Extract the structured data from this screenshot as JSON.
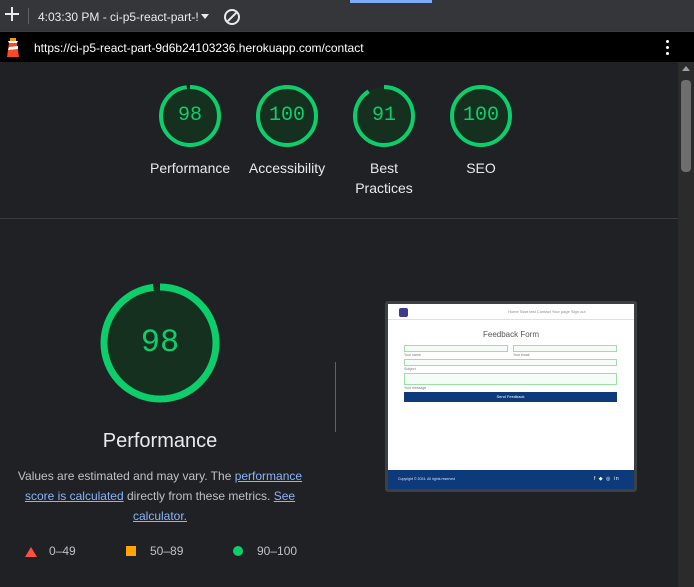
{
  "toolbar": {
    "report_label": "4:03:30 PM - ci-p5-react-part-!"
  },
  "urlbar": {
    "url": "https://ci-p5-react-part-9d6b24103236.herokuapp.com/contact"
  },
  "summary_gauges": [
    {
      "score": "98",
      "label": "Performance"
    },
    {
      "score": "100",
      "label": "Accessibility"
    },
    {
      "score": "91",
      "label_line1": "Best",
      "label_line2": "Practices"
    },
    {
      "score": "100",
      "label": "SEO"
    }
  ],
  "performance": {
    "score": "98",
    "title": "Performance",
    "note_prefix": "Values are estimated and may vary. The ",
    "note_link1": "performance score is calculated",
    "note_middle": " directly from these metrics. ",
    "note_link2": "See calculator."
  },
  "legend": [
    {
      "range": "0–49",
      "shape": "triangle",
      "color": "#ff4e42"
    },
    {
      "range": "50–89",
      "shape": "square",
      "color": "#ffa400"
    },
    {
      "range": "90–100",
      "shape": "circle",
      "color": "#0cce6b"
    }
  ],
  "screenshot": {
    "nav_items": "Home  Start test  Contact  Your page  Sign out",
    "title": "Feedback Form",
    "label_first_name": "Your name",
    "label_email": "Your email",
    "label_subject": "Subject",
    "label_message": "Your message",
    "button": "Send Feedback",
    "copyright": "Copyright © 2024. All rights reserved",
    "social": "f ◆ ◎ in"
  },
  "colors": {
    "pass": "#0cce6b",
    "average": "#ffa400",
    "fail": "#ff4e42",
    "link": "#8ab4f8",
    "background": "#202124"
  }
}
